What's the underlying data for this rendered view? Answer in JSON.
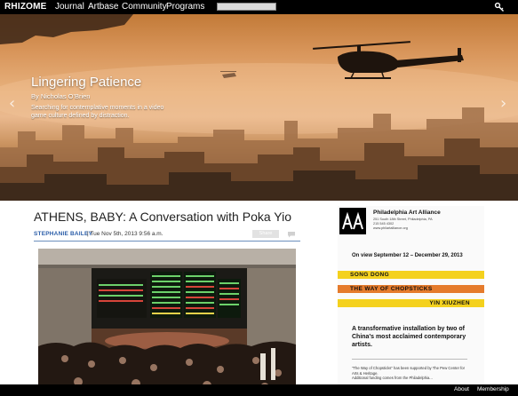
{
  "nav": {
    "logo": "RHIZOME",
    "items": [
      "Journal",
      "Artbase",
      "Community",
      "Programs"
    ],
    "search_placeholder": ""
  },
  "hero": {
    "title": "Lingering Patience",
    "byline": "By Nicholas O'Brien",
    "description": "Searching for contemplative moments in a video game culture defined by distraction.",
    "prev_arrow": "‹",
    "next_arrow": "›"
  },
  "article": {
    "title": "ATHENS, BABY: A Conversation with Poka Yio",
    "author": "STEPHANIE BAILEY",
    "date": "| Tue Nov 5th, 2013 9:56 a.m.",
    "share_label": "Share"
  },
  "ad": {
    "org": "Philadelphia Art Alliance",
    "address": [
      "251 South 18th Street, Philadelphia, PA",
      "215 545 4302",
      "www.philartalliance.org"
    ],
    "on_view": "On view September 12 – December 29, 2013",
    "band1": "SONG DONG",
    "band2": "THE WAY OF CHOPSTICKS",
    "band3": "YIN XIUZHEN",
    "tagline": "A transformative installation by two of China's most acclaimed contemporary artists.",
    "support": "\"The Way of Chopsticks\" has been supported by The Pew Center for Arts & Heritage.",
    "support2": "Additional funding comes from the Philadelphia..."
  },
  "footer": {
    "about": "About",
    "membership": "Membership"
  },
  "colors": {
    "accent_blue": "#2a5da8",
    "ad_yellow": "#f4d11e",
    "ad_orange": "#e57b2c"
  }
}
